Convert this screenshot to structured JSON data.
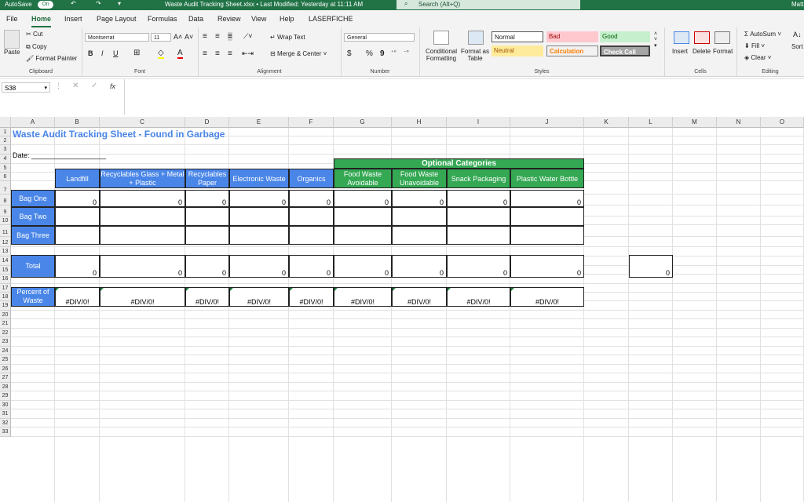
{
  "titlebar": {
    "autosave": "AutoSave",
    "autosave_state": "On",
    "doc_title": "Waste Audit Tracking Sheet.xlsx • Last Modified: Yesterday at 11:11 AM",
    "search": "Search (Alt+Q)",
    "user": "Matt"
  },
  "menu": [
    "File",
    "Home",
    "Insert",
    "Page Layout",
    "Formulas",
    "Data",
    "Review",
    "View",
    "Help",
    "LASERFICHE"
  ],
  "ribbon": {
    "clipboard": {
      "label": "Clipboard",
      "paste": "Paste",
      "cut": "Cut",
      "copy": "Copy",
      "format_painter": "Format Painter"
    },
    "font": {
      "label": "Font",
      "name": "Montserrat",
      "size": "11",
      "bold": "B",
      "italic": "I",
      "underline": "U"
    },
    "alignment": {
      "label": "Alignment",
      "wrap": "Wrap Text",
      "merge": "Merge & Center"
    },
    "number": {
      "label": "Number",
      "format": "General",
      "currency": "$",
      "percent": "%",
      "comma": "9"
    },
    "styles": {
      "label": "Styles",
      "conditional": "Conditional Formatting",
      "format_table": "Format as Table",
      "normal": "Normal",
      "bad": "Bad",
      "good": "Good",
      "neutral": "Neutral",
      "calculation": "Calculation",
      "check_cell": "Check Cell"
    },
    "cells": {
      "label": "Cells",
      "insert": "Insert",
      "delete": "Delete",
      "format": "Format"
    },
    "editing": {
      "label": "Editing",
      "autosum": "AutoSum",
      "fill": "Fill",
      "clear": "Clear",
      "sort": "Sort & Filter"
    }
  },
  "formula_bar": {
    "name_box": "S38",
    "fx": "fx",
    "value": ""
  },
  "columns": [
    "A",
    "B",
    "C",
    "D",
    "E",
    "F",
    "G",
    "H",
    "I",
    "J",
    "K",
    "L",
    "M",
    "N",
    "O"
  ],
  "rows": [
    "1",
    "2",
    "3",
    "4",
    "5",
    "6",
    "7",
    "8",
    "9",
    "10",
    "11",
    "12",
    "13",
    "14",
    "15",
    "16",
    "17",
    "18",
    "19",
    "20",
    "21",
    "22",
    "23",
    "24",
    "25",
    "26",
    "27",
    "28",
    "29",
    "30",
    "31",
    "32",
    "33"
  ],
  "sheet": {
    "title": "Waste Audit Tracking Sheet - Found in Garbage",
    "date": "Date: ___________________",
    "optional": "Optional Categories",
    "headers": [
      "Landfill",
      "Recyclables Glass + Metal + Plastic",
      "Recyclables Paper",
      "Electronic Waste",
      "Organics",
      "Food Waste Avoidable",
      "Food Waste Unavoidable",
      "Snack Packaging",
      "Plastic Water Bottle"
    ],
    "row_labels": [
      "Bag One",
      "Bag Two",
      "Bag Three",
      "Total",
      "Percent of Waste"
    ],
    "bag_one": [
      "0",
      "0",
      "0",
      "0",
      "0",
      "0",
      "0",
      "0",
      "0"
    ],
    "total": [
      "0",
      "0",
      "0",
      "0",
      "0",
      "0",
      "0",
      "0",
      "0"
    ],
    "percent": [
      "#DIV/0!",
      "#DIV/0!",
      "#DIV/0!",
      "#DIV/0!",
      "#DIV/0!",
      "#DIV/0!",
      "#DIV/0!",
      "#DIV/0!",
      "#DIV/0!"
    ],
    "grand_total": "0"
  },
  "colors": {
    "excel_green": "#217346",
    "header_blue": "#4a86e8",
    "header_green": "#34a853",
    "title_blue": "#4a86e8"
  }
}
